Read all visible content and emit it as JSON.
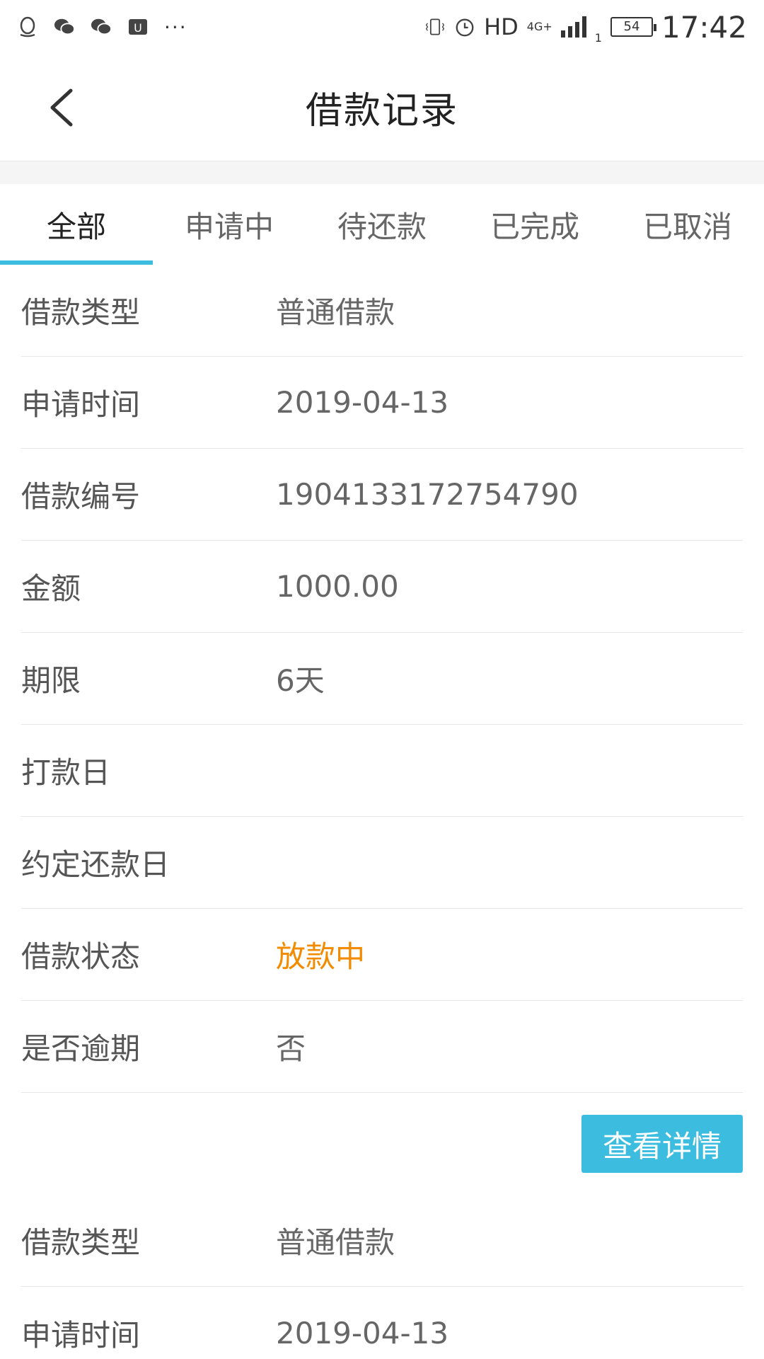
{
  "statusbar": {
    "left_icons": [
      "qq-icon",
      "wechat-icon",
      "wechat-icon",
      "app-icon"
    ],
    "dots": "···",
    "hd": "HD",
    "network": "4G+",
    "sim": "1",
    "battery": "54",
    "time": "17:42"
  },
  "header": {
    "title": "借款记录"
  },
  "tabs": [
    {
      "label": "全部",
      "active": true
    },
    {
      "label": "申请中",
      "active": false
    },
    {
      "label": "待还款",
      "active": false
    },
    {
      "label": "已完成",
      "active": false
    },
    {
      "label": "已取消",
      "active": false
    }
  ],
  "colors": {
    "accent": "#3cbde0",
    "status_orange": "#f38b00"
  },
  "records": [
    {
      "rows": [
        {
          "label": "借款类型",
          "value": "普通借款"
        },
        {
          "label": "申请时间",
          "value": "2019-04-13"
        },
        {
          "label": "借款编号",
          "value": "1904133172754790"
        },
        {
          "label": "金额",
          "value": "1000.00"
        },
        {
          "label": "期限",
          "value": "6天"
        },
        {
          "label": "打款日",
          "value": ""
        },
        {
          "label": "约定还款日",
          "value": ""
        },
        {
          "label": "借款状态",
          "value": "放款中"
        },
        {
          "label": "是否逾期",
          "value": "否"
        }
      ],
      "button": "查看详情"
    },
    {
      "rows": [
        {
          "label": "借款类型",
          "value": "普通借款"
        },
        {
          "label": "申请时间",
          "value": "2019-04-13"
        }
      ]
    }
  ]
}
